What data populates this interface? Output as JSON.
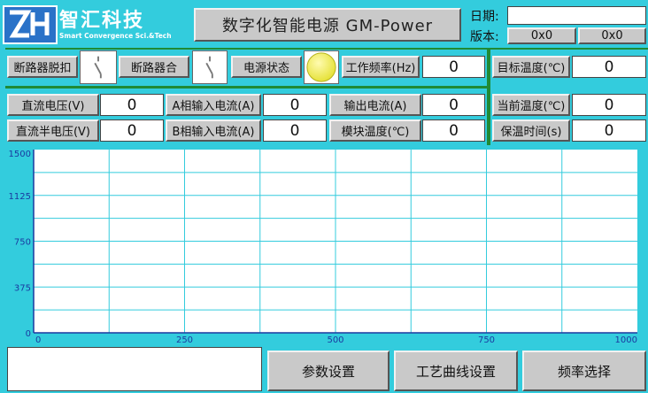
{
  "header": {
    "logo_text": "智汇科技",
    "logo_subtitle": "Smart Convergence Sci.&Tech",
    "title": "数字化智能电源 GM-Power",
    "date_label": "日期:",
    "date_value": "",
    "version_label": "版本:",
    "version_values": [
      "0x0",
      "0x0"
    ]
  },
  "controls": {
    "breaker_trip_label": "断路器脱扣",
    "breaker_close_label": "断路器合",
    "power_status_label": "电源状态",
    "power_status_color": "#e6e23a",
    "work_freq_label": "工作频率(Hz)",
    "work_freq_value": "0",
    "target_temp_label": "目标温度(℃)",
    "target_temp_value": "0"
  },
  "measurements": {
    "dc_voltage_label": "直流电压(V)",
    "dc_voltage_value": "0",
    "dc_half_voltage_label": "直流半电压(V)",
    "dc_half_voltage_value": "0",
    "phase_a_current_label": "A相输入电流(A)",
    "phase_a_current_value": "0",
    "phase_b_current_label": "B相输入电流(A)",
    "phase_b_current_value": "0",
    "output_current_label": "输出电流(A)",
    "output_current_value": "0",
    "module_temp_label": "模块温度(℃)",
    "module_temp_value": "0",
    "current_temp_label": "当前温度(℃)",
    "current_temp_value": "0",
    "hold_time_label": "保温时间(s)",
    "hold_time_value": "0"
  },
  "chart_data": {
    "type": "line",
    "title": "",
    "xlabel": "",
    "ylabel": "",
    "xlim": [
      0,
      1000
    ],
    "ylim": [
      0,
      1500
    ],
    "x_ticks": [
      "0",
      "250",
      "500",
      "750",
      "1000"
    ],
    "y_ticks": [
      "0",
      "375",
      "750",
      "1125",
      "1500"
    ],
    "grid": true,
    "series": [],
    "colors": {
      "background": "#ffffff",
      "grid": "#33ccdd",
      "axis": "#1a3aa0"
    }
  },
  "bottom": {
    "message": "",
    "param_settings_label": "参数设置",
    "process_curve_label": "工艺曲线设置",
    "freq_select_label": "频率选择"
  }
}
